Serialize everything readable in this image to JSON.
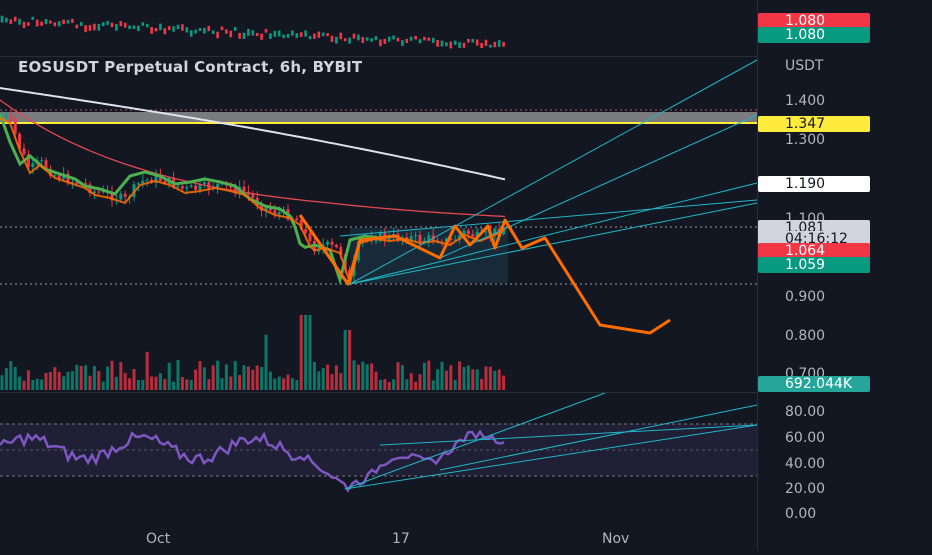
{
  "chart_data": {
    "type": "candlestick",
    "title": "EOSUSDT Perpetual Contract, 6h, BYBIT",
    "quote_currency": "USDT",
    "price_axis": {
      "labels": [
        "1.400",
        "1.300",
        "1.100",
        "0.900",
        "0.800",
        "0.700"
      ],
      "range": [
        0.67,
        1.53
      ]
    },
    "x_ticks": [
      "Oct",
      "17",
      "Nov"
    ],
    "price_tags": [
      {
        "value": "1.080",
        "bg": "#f23645",
        "fg": "#ffffff"
      },
      {
        "value": "1.080",
        "bg": "#089981",
        "fg": "#ffffff"
      },
      {
        "value": "1.347",
        "bg": "#ffeb3b",
        "fg": "#131722"
      },
      {
        "value": "1.190",
        "bg": "#ffffff",
        "fg": "#131722"
      },
      {
        "value": "1.081",
        "bg": "#d1d4dc",
        "fg": "#131722"
      },
      {
        "value": "04:16:12",
        "bg": "#d1d4dc",
        "fg": "#131722"
      },
      {
        "value": "1.064",
        "bg": "#f23645",
        "fg": "#ffffff"
      },
      {
        "value": "1.059",
        "bg": "#089981",
        "fg": "#ffffff"
      }
    ],
    "volume_tag": {
      "value": "692.044K",
      "bg": "#26a69a"
    },
    "rsi": {
      "labels": [
        "80.00",
        "60.00",
        "40.00",
        "20.00",
        "0.00"
      ],
      "levels": [
        70,
        50,
        30
      ],
      "range": [
        0,
        100
      ]
    },
    "overlay_line_colors": {
      "ma_white": "#e0e3eb",
      "ma_red": "#e5484d",
      "ma_green": "#4caf50",
      "trendlines": "#1fb7c8",
      "projection": "#ff6d00",
      "resistance": "#ffeb3b",
      "rsi": "#7e57c2"
    }
  }
}
